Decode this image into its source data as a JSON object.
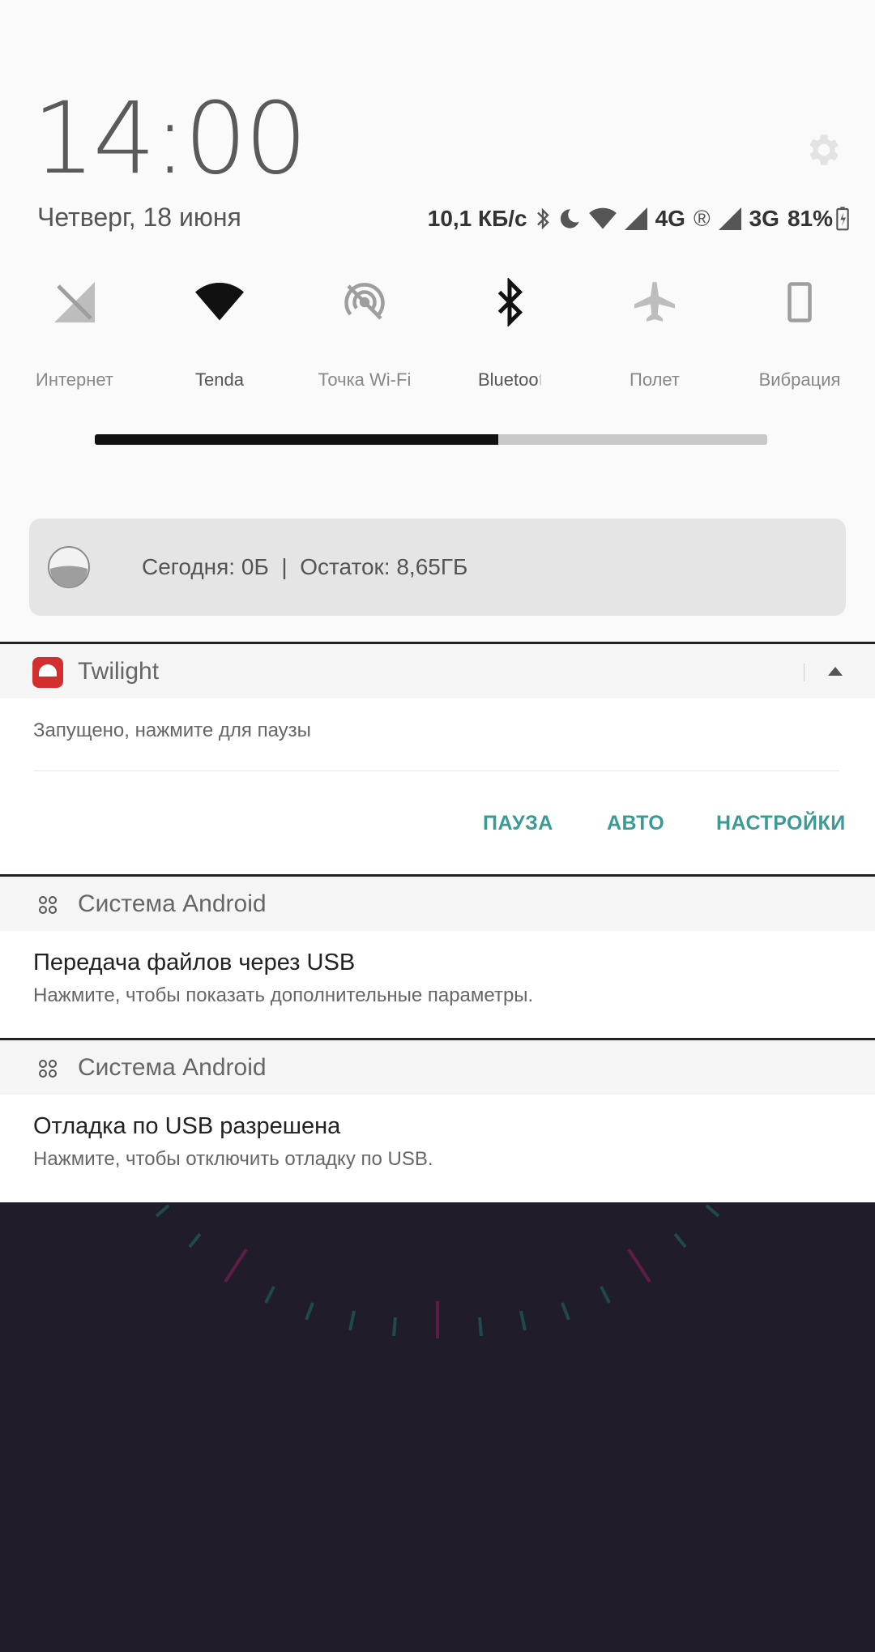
{
  "header": {
    "time": "14:00",
    "date": "Четверг, 18 июня"
  },
  "status": {
    "speed": "10,1 КБ/с",
    "net1": "4G",
    "roaming": "®",
    "net2": "3G",
    "battery": "81%"
  },
  "tiles": [
    {
      "label": "Интернет",
      "icon": "mobile-data-off-icon",
      "active": false
    },
    {
      "label": "Tenda",
      "icon": "wifi-icon",
      "active": true
    },
    {
      "label": "Точка Wi-Fi",
      "icon": "hotspot-off-icon",
      "active": false
    },
    {
      "label": "Bluetooth",
      "icon": "bluetooth-icon",
      "active": true
    },
    {
      "label": "Полет",
      "icon": "airplane-icon",
      "active": false
    },
    {
      "label": "Вибрация",
      "icon": "phone-vibrate-icon",
      "active": false
    }
  ],
  "brightness": {
    "level": 0.6
  },
  "data_usage": {
    "text": "Сегодня: 0Б  |  Остаток: 8,65ГБ"
  },
  "notifications": {
    "twilight": {
      "app": "Twilight",
      "text": "Запущено, нажмите для паузы",
      "actions": [
        "ПАУЗА",
        "АВТО",
        "НАСТРОЙКИ"
      ]
    },
    "usb_files": {
      "app": "Система Android",
      "title": "Передача файлов через USB",
      "text": "Нажмите, чтобы показать дополнительные параметры."
    },
    "usb_debug": {
      "app": "Система Android",
      "title": "Отладка по USB разрешена",
      "text": "Нажмите, чтобы отключить отладку по USB."
    }
  },
  "colors": {
    "accent": "#3b9a94",
    "twilight_red": "#d32f2f",
    "wallpaper": "#201c2a"
  }
}
